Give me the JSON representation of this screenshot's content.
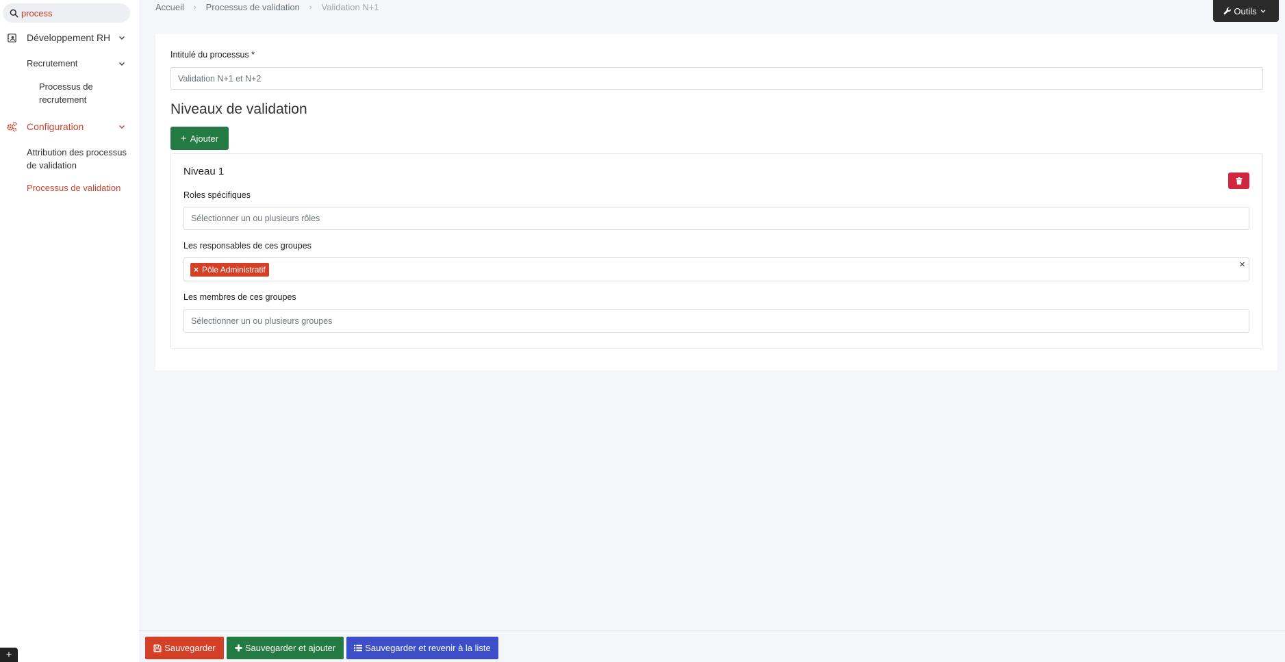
{
  "colors": {
    "accent": "#c8442f",
    "success": "#237a43",
    "danger": "#d0263f",
    "primary": "#3c4fc8",
    "dark": "#2b2b2b"
  },
  "sidebar": {
    "search": {
      "value": "process",
      "icon": "search-icon"
    },
    "items": [
      {
        "label": "Développement RH",
        "icon": "hr-development-icon"
      },
      {
        "label": "Recrutement"
      },
      {
        "label": "Processus de recrutement"
      },
      {
        "label": "Configuration",
        "icon": "gears-icon"
      },
      {
        "label": "Attribution des processus de validation"
      },
      {
        "label": "Processus de validation"
      }
    ],
    "expand_label": "+"
  },
  "breadcrumb": [
    "Accueil",
    "Processus de validation",
    "Validation N+1"
  ],
  "tools": {
    "label": "Outils"
  },
  "form": {
    "title_label": "Intitulé du processus *",
    "title_value": "Validation N+1 et N+2",
    "section_heading": "Niveaux de validation",
    "add_label": "Ajouter",
    "levels": [
      {
        "title": "Niveau 1",
        "roles_label": "Roles spécifiques",
        "roles_placeholder": "Sélectionner un ou plusieurs rôles",
        "managers_label": "Les responsables de ces groupes",
        "managers_tags": [
          "Pôle Administratif"
        ],
        "members_label": "Les membres de ces groupes",
        "members_placeholder": "Sélectionner un ou plusieurs groupes"
      }
    ]
  },
  "footer": {
    "save": "Sauvegarder",
    "save_add": "Sauvegarder et ajouter",
    "save_back": "Sauvegarder et revenir à la liste"
  }
}
